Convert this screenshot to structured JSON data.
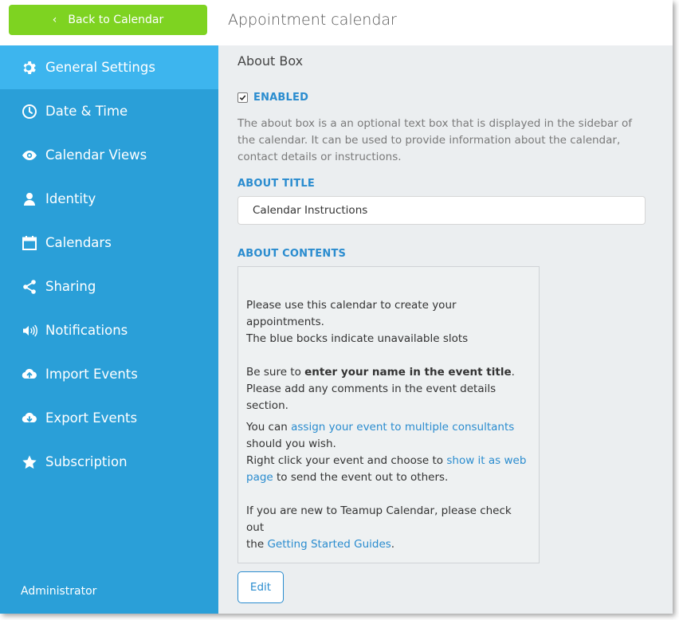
{
  "back_button": {
    "label": "Back to Calendar",
    "icon": "chevron-left-icon"
  },
  "header": {
    "title": "Appointment calendar"
  },
  "sidebar": {
    "items": [
      {
        "label": "General Settings",
        "icon": "gear-icon",
        "active": true
      },
      {
        "label": "Date & Time",
        "icon": "clock-icon"
      },
      {
        "label": "Calendar Views",
        "icon": "eye-icon"
      },
      {
        "label": "Identity",
        "icon": "user-icon"
      },
      {
        "label": "Calendars",
        "icon": "calendar-icon"
      },
      {
        "label": "Sharing",
        "icon": "share-icon"
      },
      {
        "label": "Notifications",
        "icon": "speaker-icon"
      },
      {
        "label": "Import Events",
        "icon": "cloud-upload-icon"
      },
      {
        "label": "Export Events",
        "icon": "cloud-download-icon"
      },
      {
        "label": "Subscription",
        "icon": "star-icon"
      }
    ],
    "footer": "Administrator"
  },
  "main": {
    "section_title": "About Box",
    "enabled": {
      "label": "ENABLED",
      "checked": true
    },
    "description": "The about box is a an optional text box that is displayed in the sidebar of the calendar. It can be used to provide information about the calendar, contact details or instructions.",
    "about_title": {
      "label": "ABOUT TITLE",
      "value": "Calendar Instructions"
    },
    "about_contents": {
      "label": "ABOUT CONTENTS",
      "line1": "Please use this calendar to create your appointments.",
      "line2": "The blue bocks indicate unavailable slots",
      "line3_pre": "Be sure to ",
      "line3_bold": "enter your name in the event title",
      "line3_post": ".",
      "line4": "Please add any comments in the event details section.",
      "line5_pre": "You can ",
      "line5_link": "assign your event to multiple consultants",
      "line6": "should you wish.",
      "line7_pre": "Right click your event and choose to ",
      "line7_link": "show it as web page",
      "line7_post": " to send the event out to others.",
      "line8": "If you are new to Teamup Calendar, please check out",
      "line9_pre": "the ",
      "line9_link": "Getting Started Guides",
      "line9_post": "."
    },
    "edit_button": "Edit"
  },
  "colors": {
    "sidebar": "#2a9fd8",
    "sidebar_active": "#3db5ee",
    "back_button": "#7ed321",
    "accent": "#2a8ccf",
    "content_bg": "#ebeef0"
  }
}
